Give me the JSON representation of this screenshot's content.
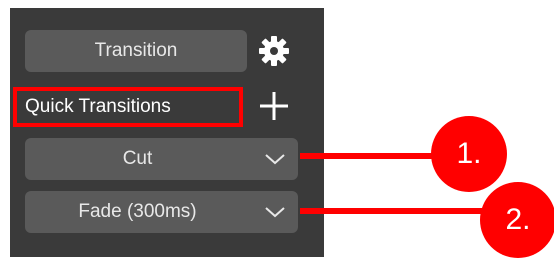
{
  "transition_button": {
    "label": "Transition"
  },
  "quick_transitions": {
    "label": "Quick Transitions"
  },
  "dropdowns": [
    {
      "value": "Cut"
    },
    {
      "value": "Fade (300ms)"
    }
  ],
  "callouts": [
    {
      "label": "1."
    },
    {
      "label": "2."
    }
  ],
  "icons": {
    "settings": "gear-icon",
    "add": "plus-icon",
    "dropdown": "chevron-down-icon"
  },
  "colors": {
    "panel": "#3a3a3a",
    "button": "#5a5a5a",
    "highlight": "#ff0000",
    "text": "#e8e8e8"
  }
}
